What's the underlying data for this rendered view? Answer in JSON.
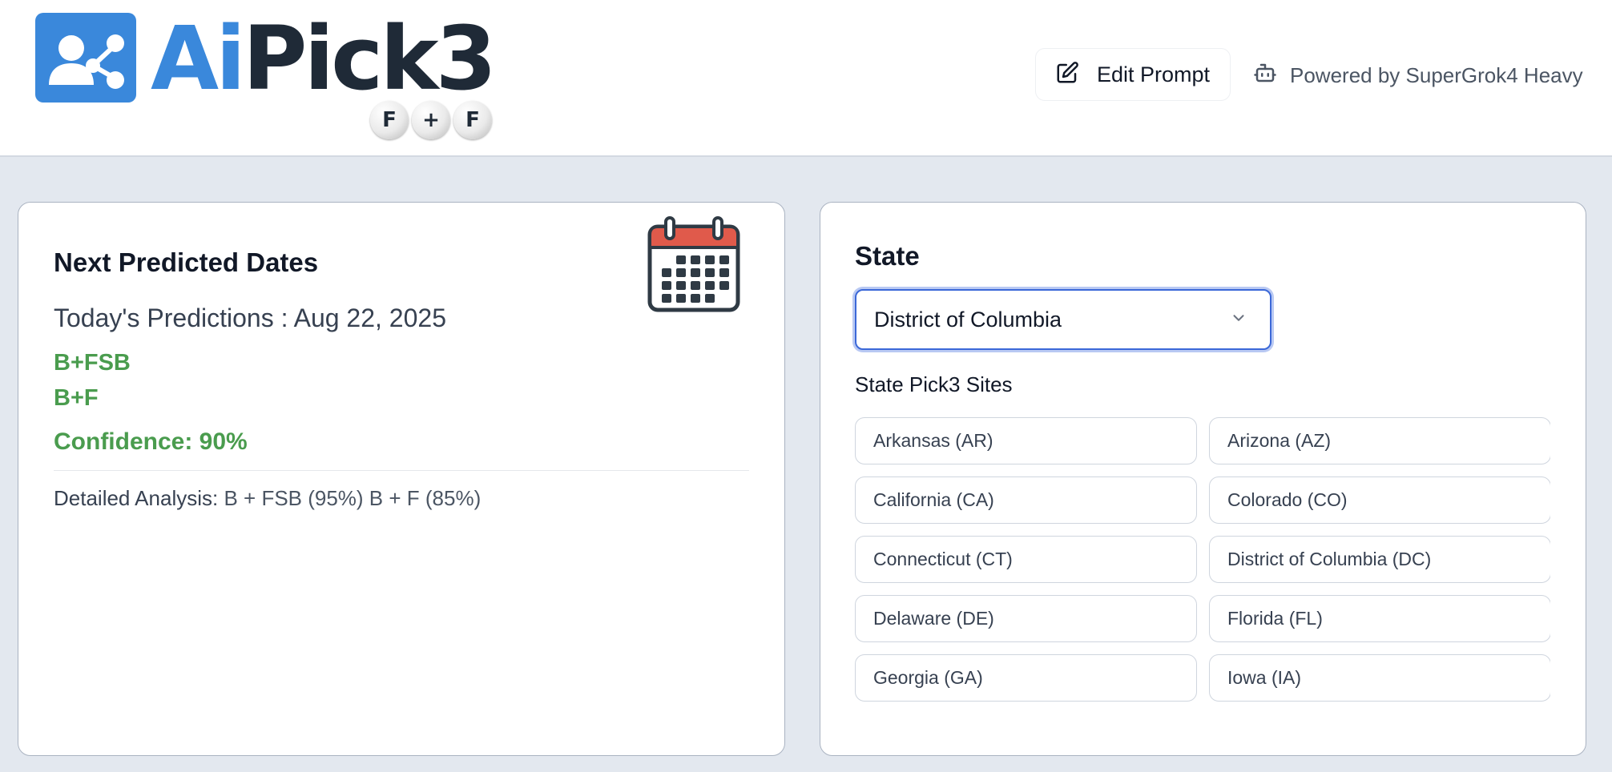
{
  "header": {
    "logo": {
      "text_ai": "Ai",
      "text_pick": "Pick3",
      "balls": [
        "F",
        "+",
        "F"
      ]
    },
    "edit_prompt_label": "Edit Prompt",
    "powered_by": "Powered by SuperGrok4 Heavy"
  },
  "predictions": {
    "title": "Next Predicted Dates",
    "today_label": "Today's Predictions : Aug 22, 2025",
    "picks": [
      "B+FSB",
      "B+F"
    ],
    "confidence": "Confidence: 90%",
    "analysis_label": "Detailed Analysis:",
    "analysis_value": "B + FSB (95%) B + F (85%)"
  },
  "state": {
    "title": "State",
    "selected": "District of Columbia",
    "sites_title": "State Pick3 Sites",
    "sites": [
      "Arkansas (AR)",
      "Arizona (AZ)",
      "California (CA)",
      "Colorado (CO)",
      "Connecticut (CT)",
      "District of Columbia (DC)",
      "Delaware (DE)",
      "Florida (FL)",
      "Georgia (GA)",
      "Iowa (IA)"
    ]
  },
  "colors": {
    "brand_blue": "#3a88db",
    "accent_green": "#4a9c4e",
    "focus_blue": "#3b68d8",
    "calendar_red": "#e05a4b"
  },
  "icons": {
    "logo": "share-user-icon",
    "edit": "edit-icon",
    "powered": "robot-icon",
    "calendar": "calendar-icon",
    "select": "chevron-down-icon"
  }
}
